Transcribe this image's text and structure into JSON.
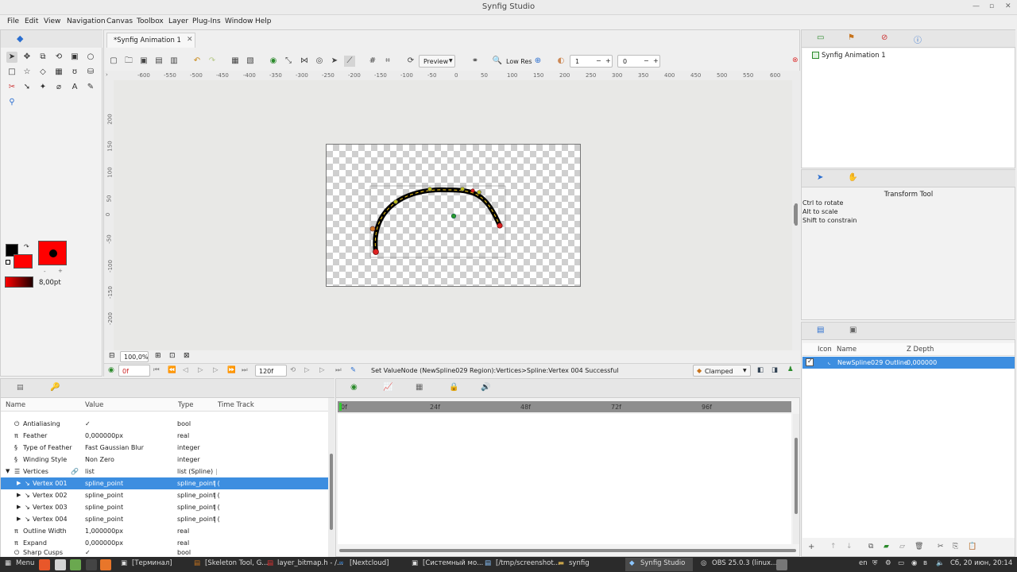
{
  "window": {
    "title": "Synfig Studio"
  },
  "menu": [
    "File",
    "Edit",
    "View",
    "Navigation",
    "Canvas",
    "Toolbox",
    "Layer",
    "Plug-Ins",
    "Window",
    "Help"
  ],
  "document_tab": {
    "label": "*Synfig Animation 1"
  },
  "toolbar": {
    "preview_label": "Preview",
    "lowres_label": "Low Res",
    "onion_past": "1",
    "onion_future": "0"
  },
  "ruler": {
    "ticks": [
      "-600",
      "-550",
      "-500",
      "-450",
      "-400",
      "-350",
      "-300",
      "-250",
      "-200",
      "-150",
      "-100",
      "-50",
      "0",
      "50",
      "100",
      "150",
      "200",
      "250",
      "300",
      "350",
      "400",
      "450",
      "500",
      "550",
      "600"
    ]
  },
  "vruler": {
    "ticks": [
      "200",
      "150",
      "100",
      "50",
      "0",
      "-50",
      "-100",
      "-150",
      "-200"
    ]
  },
  "toolbox": {
    "brush_size": "8,00pt"
  },
  "canvas_bottom": {
    "zoom": "100,0%"
  },
  "timebar": {
    "current_time": "0f",
    "end_time": "120f",
    "status": "Set ValueNode (NewSpline029 Region):Vertices>Spline:Vertex 004 Successful",
    "interpolation": "Clamped"
  },
  "params": {
    "headers": {
      "name": "Name",
      "value": "Value",
      "type": "Type",
      "time_track": "Time Track"
    },
    "rows": [
      {
        "name": "Antialiasing",
        "value": "✓",
        "type": "bool"
      },
      {
        "name": "Feather",
        "value": "0,000000px",
        "type": "real"
      },
      {
        "name": "Type of Feather",
        "value": "Fast Gaussian Blur",
        "type": "integer"
      },
      {
        "name": "Winding Style",
        "value": "Non Zero",
        "type": "integer"
      },
      {
        "name": "Vertices",
        "value": "list",
        "type": "list (Spline)"
      },
      {
        "name": "Vertex 001",
        "value": "spline_point",
        "type": "spline_point ("
      },
      {
        "name": "Vertex 002",
        "value": "spline_point",
        "type": "spline_point ("
      },
      {
        "name": "Vertex 003",
        "value": "spline_point",
        "type": "spline_point ("
      },
      {
        "name": "Vertex 004",
        "value": "spline_point",
        "type": "spline_point ("
      },
      {
        "name": "Outline Width",
        "value": "1,000000px",
        "type": "real"
      },
      {
        "name": "Expand",
        "value": "0,000000px",
        "type": "real"
      },
      {
        "name": "Sharp Cusps",
        "value": "✓",
        "type": "bool"
      }
    ]
  },
  "timetrack": {
    "labels": [
      "0f",
      "24f",
      "48f",
      "72f",
      "96f"
    ]
  },
  "canvas_browser": {
    "item": "Synfig Animation 1"
  },
  "tool_options": {
    "title": "Transform Tool",
    "hints": [
      "Ctrl to rotate",
      "Alt to scale",
      "Shift to constrain"
    ]
  },
  "layers": {
    "headers": {
      "icon": "Icon",
      "name": "Name",
      "zdepth": "Z Depth"
    },
    "rows": [
      {
        "name": "NewSpline029 Outline",
        "zdepth": "0,000000"
      }
    ]
  },
  "taskbar": {
    "menu": "Menu",
    "tasks": [
      "[Терминал]",
      "[Skeleton Tool, G...",
      "layer_bitmap.h - /...",
      "[Nextcloud]",
      "[Системный мо...",
      "[/tmp/screenshot...",
      "synfig",
      "Synfig Studio",
      "OBS 25.0.3 (linux..."
    ],
    "lang": "en",
    "clock": "Сб, 20 июн, 20:14"
  },
  "colors": {
    "accent": "#3d8ee0",
    "fill": "#ff0000",
    "outline": "#000000"
  }
}
